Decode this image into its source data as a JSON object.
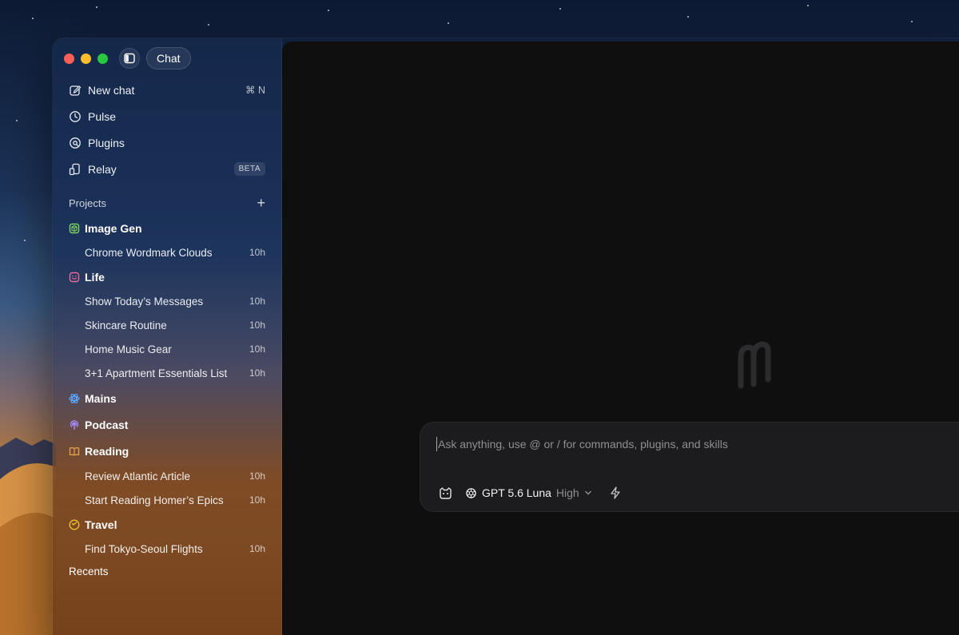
{
  "window": {
    "title_pill": "Chat"
  },
  "nav": [
    {
      "label": "New chat",
      "shortcut": "⌘ N",
      "icon": "edit-icon"
    },
    {
      "label": "Pulse",
      "icon": "clock-icon"
    },
    {
      "label": "Plugins",
      "icon": "plugins-icon"
    },
    {
      "label": "Relay",
      "badge": "BETA",
      "icon": "relay-icon"
    }
  ],
  "projects": {
    "heading": "Projects",
    "add_symbol": "+",
    "groups": [
      {
        "name": "Image Gen",
        "color": "#7dd35f",
        "icon": "cube-icon",
        "threads": [
          {
            "title": "Chrome Wordmark Clouds",
            "time": "10h"
          }
        ]
      },
      {
        "name": "Life",
        "color": "#e86a9c",
        "icon": "smile-icon",
        "threads": [
          {
            "title": "Show Today’s Messages",
            "time": "10h"
          },
          {
            "title": "Skincare Routine",
            "time": "10h"
          },
          {
            "title": "Home Music Gear",
            "time": "10h"
          },
          {
            "title": "3+1 Apartment Essentials List",
            "time": "10h"
          }
        ]
      },
      {
        "name": "Mains",
        "color": "#5aa8ff",
        "icon": "atom-icon",
        "threads": []
      },
      {
        "name": "Podcast",
        "color": "#a68cff",
        "icon": "podcast-icon",
        "threads": []
      },
      {
        "name": "Reading",
        "color": "#e8a24a",
        "icon": "book-icon",
        "threads": [
          {
            "title": "Review Atlantic Article",
            "time": "10h"
          },
          {
            "title": "Start Reading Homer’s Epics",
            "time": "10h"
          }
        ]
      },
      {
        "name": "Travel",
        "color": "#f2c230",
        "icon": "compass-icon",
        "threads": [
          {
            "title": "Find Tokyo-Seoul Flights",
            "time": "10h"
          }
        ]
      }
    ]
  },
  "recents": {
    "heading": "Recents"
  },
  "composer": {
    "placeholder": "Ask anything, use @ or / for commands, plugins, and skills",
    "model_name": "GPT 5.6 Luna",
    "effort": "High"
  }
}
